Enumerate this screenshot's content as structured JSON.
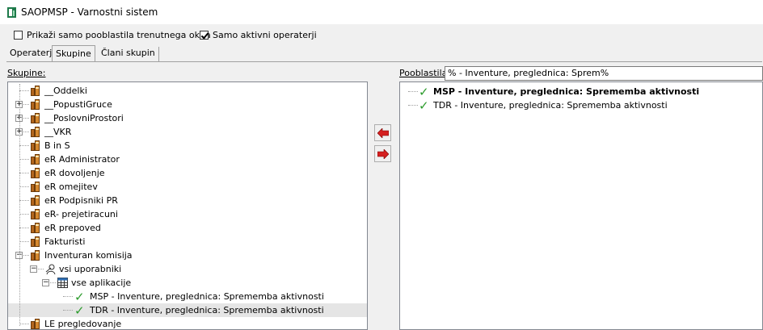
{
  "window": {
    "title": "SAOPMSP - Varnostni sistem"
  },
  "options": {
    "show_current_window": {
      "label": "Prikaži samo pooblastila trenutnega okna",
      "checked": false
    },
    "active_operators": {
      "label": "Samo aktivni operaterji",
      "checked": true
    }
  },
  "tabs": [
    "Operaterji",
    "Skupine",
    "Člani skupin"
  ],
  "active_tab": "Skupine",
  "groups_label": "Skupine:",
  "permissions_label": "Pooblastila:",
  "filter_value": "% - Inventure, preglednica: Sprem%",
  "tree": [
    {
      "label": "__Oddelki",
      "level": 0,
      "icon": "group-icon",
      "expander": ""
    },
    {
      "label": "__PopustiGruce",
      "level": 0,
      "icon": "group-icon",
      "expander": "+"
    },
    {
      "label": "__PoslovniProstori",
      "level": 0,
      "icon": "group-icon",
      "expander": "+"
    },
    {
      "label": "__VKR",
      "level": 0,
      "icon": "group-icon",
      "expander": "+"
    },
    {
      "label": "B in S",
      "level": 0,
      "icon": "group-icon",
      "expander": ""
    },
    {
      "label": "eR Administrator",
      "level": 0,
      "icon": "group-icon",
      "expander": ""
    },
    {
      "label": "eR dovoljenje",
      "level": 0,
      "icon": "group-icon",
      "expander": ""
    },
    {
      "label": "eR omejitev",
      "level": 0,
      "icon": "group-icon",
      "expander": ""
    },
    {
      "label": "eR Podpisniki PR",
      "level": 0,
      "icon": "group-icon",
      "expander": ""
    },
    {
      "label": "eR- prejetiracuni",
      "level": 0,
      "icon": "group-icon",
      "expander": ""
    },
    {
      "label": "eR prepoved",
      "level": 0,
      "icon": "group-icon",
      "expander": ""
    },
    {
      "label": "Fakturisti",
      "level": 0,
      "icon": "group-icon",
      "expander": ""
    },
    {
      "label": "Inventuran komisija",
      "level": 0,
      "icon": "group-icon",
      "expander": "−"
    },
    {
      "label": "vsi uporabniki",
      "level": 1,
      "icon": "users-icon",
      "expander": "−"
    },
    {
      "label": "vse aplikacije",
      "level": 2,
      "icon": "grid-icon",
      "expander": "−"
    },
    {
      "label": "MSP - Inventure, preglednica: Sprememba aktivnosti",
      "level": 3,
      "icon": "check-icon",
      "expander": ""
    },
    {
      "label": "TDR - Inventure, preglednica: Sprememba aktivnosti",
      "level": 3,
      "icon": "check-icon",
      "expander": "",
      "selected": true
    },
    {
      "label": "LE pregledovanje",
      "level": 0,
      "icon": "group-icon",
      "expander": ""
    }
  ],
  "permissions": [
    {
      "label": "MSP - Inventure, preglednica: Sprememba aktivnosti",
      "bold": true
    },
    {
      "label": "TDR - Inventure, preglednica: Sprememba aktivnosti",
      "bold": false
    }
  ],
  "buttons": {
    "add": "add-arrow-icon",
    "remove": "remove-arrow-icon"
  },
  "colors": {
    "check": "#2c9b2c",
    "arrow": "#d42020",
    "group_icon": "#d6892f"
  }
}
